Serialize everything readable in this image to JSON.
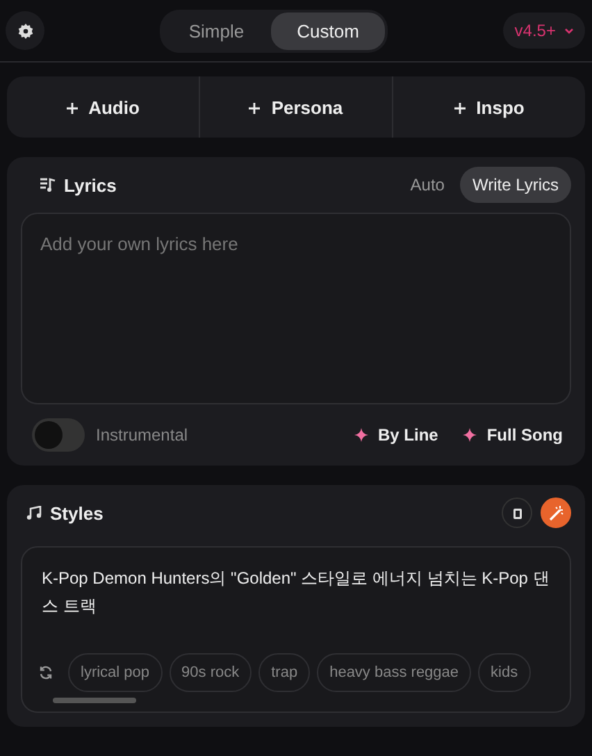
{
  "mode_tabs": [
    {
      "label": "Simple",
      "selected": false
    },
    {
      "label": "Custom",
      "selected": true
    }
  ],
  "version": {
    "label": "v4.5+"
  },
  "add_buttons": [
    {
      "label": "Audio"
    },
    {
      "label": "Persona"
    },
    {
      "label": "Inspo"
    }
  ],
  "lyrics": {
    "title": "Lyrics",
    "tabs": [
      {
        "label": "Auto",
        "selected": false
      },
      {
        "label": "Write Lyrics",
        "selected": true
      }
    ],
    "placeholder": "Add your own lyrics here",
    "instrumental": {
      "label": "Instrumental",
      "on": false
    },
    "actions": [
      {
        "label": "By Line"
      },
      {
        "label": "Full Song"
      }
    ]
  },
  "styles": {
    "title": "Styles",
    "value": "K-Pop Demon Hunters의 \"Golden\" 스타일로 에너지 넘치는 K-Pop 댄스 트랙",
    "tags": [
      {
        "label": "lyrical pop"
      },
      {
        "label": "90s rock"
      },
      {
        "label": "trap"
      },
      {
        "label": "heavy bass reggae"
      },
      {
        "label": "kids"
      }
    ]
  }
}
